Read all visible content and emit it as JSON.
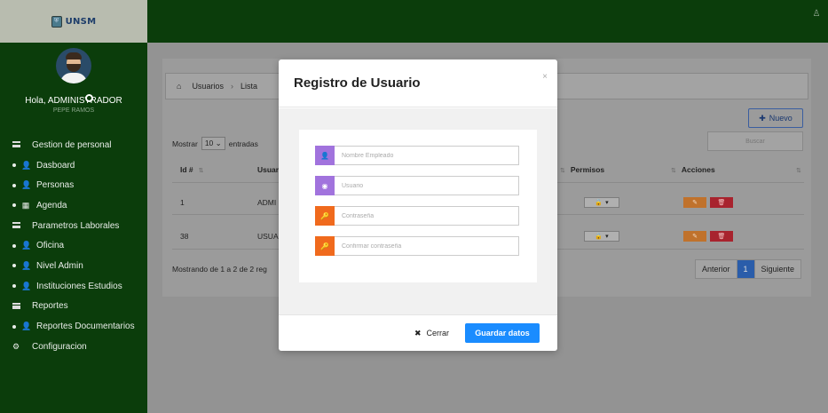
{
  "brand": {
    "logo_icon": "shield-logo-icon",
    "name": "UNSM"
  },
  "user": {
    "greeting": "Hola, ADMINISTRADOR",
    "subname": "PEPE RAMOS"
  },
  "sidebar": {
    "items": [
      {
        "type": "section",
        "icon": "bars-icon",
        "label": "Gestion de personal"
      },
      {
        "type": "item",
        "icon": "user-icon",
        "label": "Dasboard"
      },
      {
        "type": "item",
        "icon": "user-icon",
        "label": "Personas"
      },
      {
        "type": "item",
        "icon": "calendar-icon",
        "label": "Agenda"
      },
      {
        "type": "section",
        "icon": "bars-icon",
        "label": "Parametros Laborales"
      },
      {
        "type": "item",
        "icon": "user-icon",
        "label": "Oficina"
      },
      {
        "type": "item",
        "icon": "user-icon",
        "label": "Nivel Admin"
      },
      {
        "type": "item",
        "icon": "user-icon",
        "label": "Instituciones Estudios"
      },
      {
        "type": "section",
        "icon": "bars-icon",
        "label": "Reportes"
      },
      {
        "type": "item",
        "icon": "user-icon",
        "label": "Reportes Documentarios"
      },
      {
        "type": "section",
        "icon": "gear-icon",
        "label": "Configuracion"
      }
    ]
  },
  "breadcrumb": {
    "home_icon": "home-icon",
    "items": [
      "Usuarios",
      "Lista"
    ]
  },
  "toolbar": {
    "nuevo_label": "Nuevo",
    "nuevo_icon": "plus-icon"
  },
  "table_controls": {
    "show_label": "Mostrar",
    "show_value": "10",
    "entries_label": "entradas",
    "search_placeholder": "Buscar"
  },
  "table": {
    "columns": [
      "Id #",
      "Usuar",
      "Permisos",
      "Acciones"
    ],
    "rows": [
      {
        "id": "1",
        "user": "ADMI"
      },
      {
        "id": "38",
        "user": "USUA"
      }
    ],
    "footer": "Mostrando de 1 a 2 de 2 reg",
    "pagination": {
      "prev": "Anterior",
      "current": "1",
      "next": "Siguiente"
    }
  },
  "modal": {
    "title": "Registro de Usuario",
    "close_glyph": "×",
    "fields": [
      {
        "name": "employee",
        "placeholder": "Nombre Empleado",
        "icon": "user-icon",
        "color": "#a173dd"
      },
      {
        "name": "username",
        "placeholder": "Usuario",
        "icon": "user-circle-icon",
        "color": "#a173dd"
      },
      {
        "name": "password",
        "placeholder": "Contraseña",
        "icon": "key-icon",
        "color": "#f06a1d"
      },
      {
        "name": "confirm",
        "placeholder": "Confirmar contraseña",
        "icon": "key-icon",
        "color": "#f06a1d"
      }
    ],
    "cancel_label": "Cerrar",
    "cancel_icon": "close-icon",
    "save_label": "Guardar datos"
  },
  "colors": {
    "sidebar": "#0b3d0b",
    "primary": "#1a8cff",
    "purple": "#a173dd",
    "orange": "#f06a1d"
  }
}
